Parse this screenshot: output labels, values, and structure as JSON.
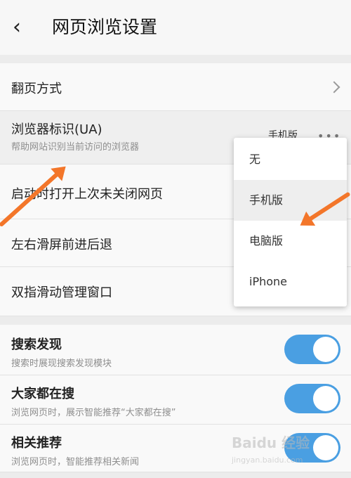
{
  "header": {
    "back_icon": "chevron-left-icon",
    "title": "网页浏览设置"
  },
  "settings": {
    "page_turn": {
      "label": "翻页方式"
    },
    "ua": {
      "label": "浏览器标识(UA)",
      "sub": "帮助网站识别当前访问的浏览器",
      "value": "手机版",
      "more_icon": "more-dots-icon"
    },
    "restore_tabs": {
      "label": "启动时打开上次未关闭网页"
    },
    "swipe_nav": {
      "label": "左右滑屏前进后退"
    },
    "two_finger": {
      "label": "双指滑动管理窗口"
    },
    "search_discover": {
      "label": "搜索发现",
      "sub": "搜索时展现搜索发现模块",
      "on": true
    },
    "everyone_search": {
      "label": "大家都在搜",
      "sub": "浏览网页时，展示智能推荐“大家都在搜”",
      "on": true
    },
    "related": {
      "label": "相关推荐",
      "sub": "浏览网页时，智能推荐相关新闻",
      "on": true
    }
  },
  "ua_dropdown": {
    "options": [
      "无",
      "手机版",
      "电脑版",
      "iPhone"
    ],
    "selected": "手机版"
  },
  "annotations": {
    "arrow_color": "#f3762a"
  },
  "watermark": {
    "text": "Baidu 经验",
    "url": "jingyan.baidu.com"
  },
  "colors": {
    "toggle_on": "#4a9fe2",
    "background": "#ececec"
  }
}
